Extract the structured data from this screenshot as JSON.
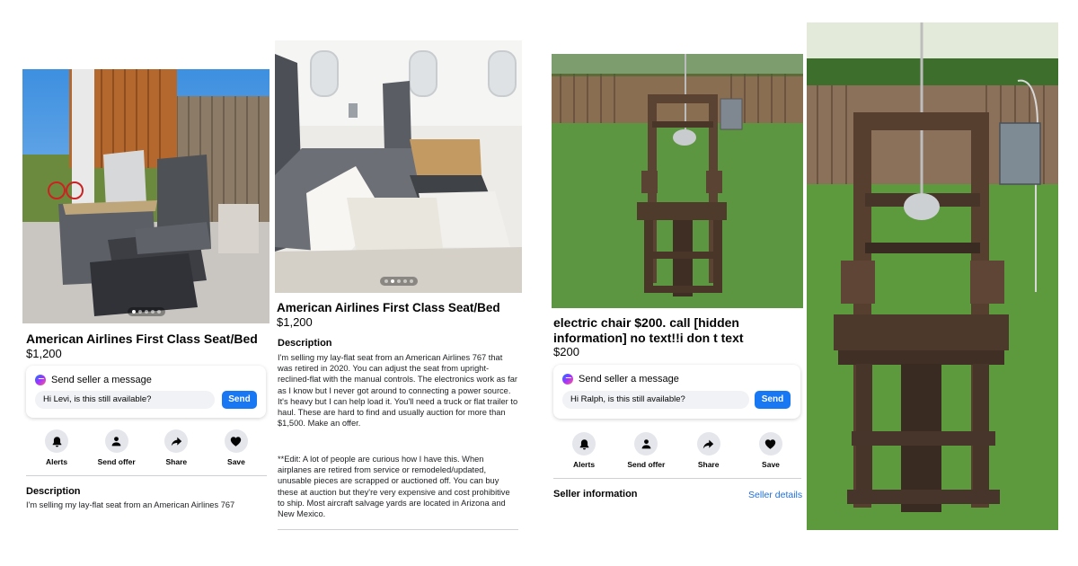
{
  "colors": {
    "accent": "#1877f2",
    "link": "#216fdb",
    "chip": "#e4e6eb"
  },
  "listing1": {
    "title": "American Airlines First Class Seat/Bed",
    "price": "$1,200",
    "message": {
      "header": "Send seller a message",
      "input_value": "Hi Levi, is this still available?",
      "send_label": "Send"
    },
    "actions": [
      {
        "label": "Alerts",
        "icon": "bell-icon"
      },
      {
        "label": "Send offer",
        "icon": "send-offer-icon"
      },
      {
        "label": "Share",
        "icon": "share-icon"
      },
      {
        "label": "Save",
        "icon": "heart-icon"
      }
    ],
    "description_heading": "Description",
    "description_preview": "I'm selling my lay-flat seat from an American Airlines 767"
  },
  "listing2": {
    "title": "American Airlines First Class Seat/Bed",
    "price": "$1,200",
    "description_heading": "Description",
    "description_p1": "I'm selling my lay-flat seat from an American Airlines 767 that was retired in 2020. You can adjust the seat from upright-reclined-flat with the manual controls. The electronics work as far as I know but I never got around to connecting a power source. It's heavy but I can help load it. You'll need a truck or flat trailer to haul. These are hard to find and usually auction for more than $1,500. Make an offer.",
    "description_p2": "**Edit: A lot of people are curious how I have this. When airplanes are retired from service or remodeled/updated, unusable pieces are scrapped or auctioned off. You can buy these at auction but they're very expensive and cost prohibitive to ship. Most aircraft salvage yards are located in Arizona and New Mexico."
  },
  "listing3": {
    "title": "electric chair  $200.  call [hidden information] no text!!i don t text",
    "price": "$200",
    "message": {
      "header": "Send seller a message",
      "input_value": "Hi Ralph, is this still available?",
      "send_label": "Send"
    },
    "actions": [
      {
        "label": "Alerts",
        "icon": "bell-icon"
      },
      {
        "label": "Send offer",
        "icon": "send-offer-icon"
      },
      {
        "label": "Share",
        "icon": "share-icon"
      },
      {
        "label": "Save",
        "icon": "heart-icon"
      }
    ],
    "seller_heading": "Seller information",
    "seller_link": "Seller details"
  }
}
